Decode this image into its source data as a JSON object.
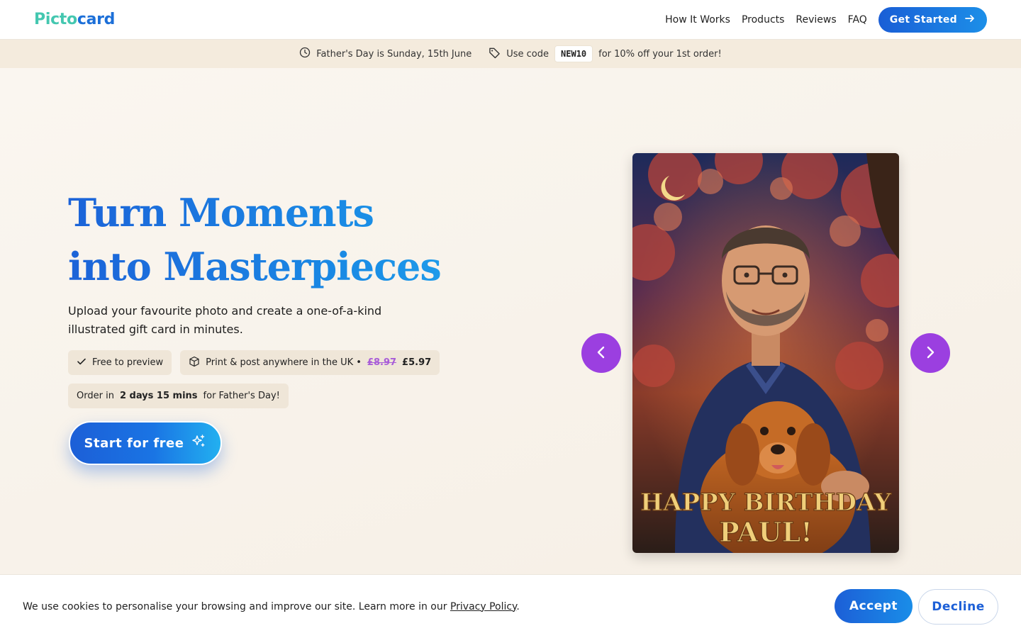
{
  "brand": {
    "logo_part1": "Picto",
    "logo_part2": "card"
  },
  "nav": {
    "items": [
      {
        "label": "How It Works"
      },
      {
        "label": "Products"
      },
      {
        "label": "Reviews"
      },
      {
        "label": "FAQ"
      }
    ],
    "cta_label": "Get Started"
  },
  "promo": {
    "date_text": "Father's Day is Sunday, 15th June",
    "code_prefix": "Use code",
    "code": "NEW10",
    "code_suffix": "for 10% off your 1st order!"
  },
  "hero": {
    "headline_line1": "Turn Moments",
    "headline_line2": "into Masterpieces",
    "subhead": "Upload your favourite photo and create a one-of-a-kind illustrated gift card in minutes.",
    "pill_preview": "Free to preview",
    "pill_print": "Print & post anywhere in the UK •",
    "price_old": "£8.97",
    "price_new": "£5.97",
    "countdown_prefix": "Order in",
    "countdown_time": "2 days 15 mins",
    "countdown_suffix": "for Father's Day!",
    "start_label": "Start for free"
  },
  "card": {
    "line1": "HAPPY BIRTHDAY",
    "line2": "PAUL!"
  },
  "cookie": {
    "text": "We use cookies to personalise your browsing and improve our site. Learn more in our",
    "link_label": "Privacy Policy",
    "period": ".",
    "accept_label": "Accept",
    "decline_label": "Decline"
  },
  "colors": {
    "brand_blue": "#1c6fd8",
    "brand_teal": "#44c7b0",
    "carousel_purple": "#9b3fe0",
    "promo_bg": "#f4ebdd"
  }
}
